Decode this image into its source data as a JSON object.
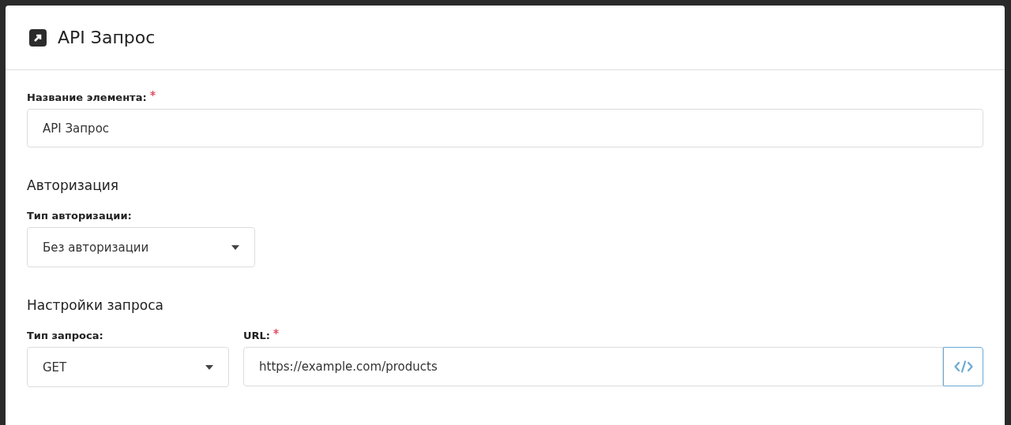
{
  "window": {
    "title": "API Запрос"
  },
  "fields": [
    {
      "kind": "text",
      "label": "Название элемента:",
      "required": true,
      "value": "API Запрос"
    }
  ],
  "sections": [
    {
      "title": "Авторизация",
      "fields": [
        {
          "kind": "select",
          "label": "Тип авторизации:",
          "required": false,
          "value": "Без авторизации"
        }
      ]
    },
    {
      "title": "Настройки запроса",
      "fields": [
        {
          "kind": "select",
          "label": "Тип запроса:",
          "required": false,
          "value": "GET"
        },
        {
          "kind": "url",
          "label": "URL:",
          "required": true,
          "value": "https://example.com/products"
        }
      ]
    }
  ]
}
